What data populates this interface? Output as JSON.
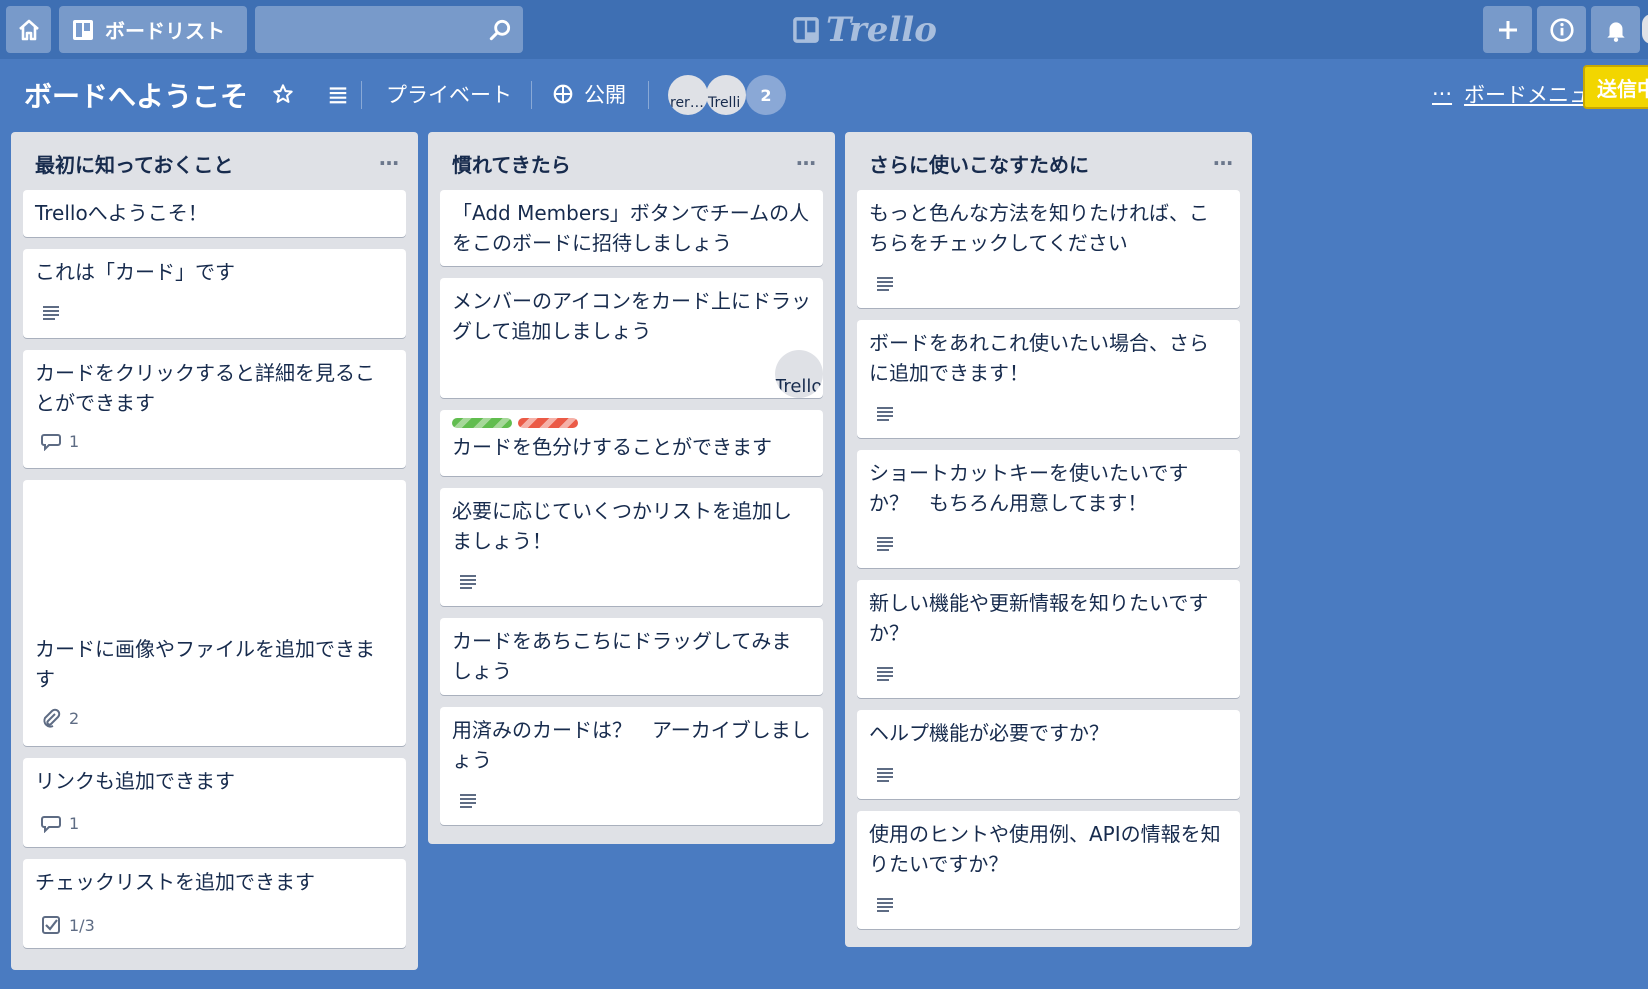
{
  "topbar": {
    "boards_label": "ボードリスト",
    "search_placeholder": "",
    "logo_text": "Trello"
  },
  "board": {
    "title": "ボードへようこそ",
    "privacy": "プライベート",
    "visibility": "公開",
    "members": [
      {
        "alt": "rer…"
      },
      {
        "alt": "Trelli"
      }
    ],
    "member_count": "2",
    "menu_label": "ボードメニュー",
    "sending_badge": "送信中"
  },
  "lists": [
    {
      "title": "最初に知っておくこと",
      "menu": "…",
      "cards": [
        {
          "title": "Trelloへようこそ！"
        },
        {
          "title": "これは「カード」です",
          "badge": "description"
        },
        {
          "title": "カードをクリックすると詳細を見ることができます",
          "comments": "1"
        },
        {
          "title": "カードに画像やファイルを追加できます",
          "attachments": "2"
        },
        {
          "title": "リンクも追加できます",
          "comments": "1"
        },
        {
          "title": "チェックリストを追加できます",
          "checklist": "1/3"
        }
      ]
    },
    {
      "title": "慣れてきたら",
      "menu": "…",
      "cards": [
        {
          "title": "「Add Members」ボタンでチームの人をこのボードに招待しましょう"
        },
        {
          "title": "メンバーのアイコンをカード上にドラッグして追加しましょう",
          "member": "Trello"
        },
        {
          "title": "カードを色分けすることができます",
          "labels": [
            "green",
            "red"
          ]
        },
        {
          "title": "必要に応じていくつかリストを追加しましょう！",
          "badge": "description"
        },
        {
          "title": "カードをあちこちにドラッグしてみましょう"
        },
        {
          "title": "用済みのカードは？　アーカイブしましょう",
          "badge": "description"
        }
      ]
    },
    {
      "title": "さらに使いこなすために",
      "menu": "…",
      "cards": [
        {
          "title": "もっと色んな方法を知りたければ、こちらをチェックしてください",
          "badge": "description"
        },
        {
          "title": "ボードをあれこれ使いたい場合、さらに追加できます！",
          "badge": "description"
        },
        {
          "title": "ショートカットキーを使いたいですか？　もちろん用意してます！",
          "badge": "description"
        },
        {
          "title": "新しい機能や更新情報を知りたいですか？",
          "badge": "description"
        },
        {
          "title": "ヘルプ機能が必要ですか？",
          "badge": "description"
        },
        {
          "title": "使用のヒントや使用例、APIの情報を知りたいですか？",
          "badge": "description"
        }
      ]
    }
  ],
  "colors": {
    "background": "#4a7bc1",
    "topbar": "#3e6fb3",
    "list": "#dfe1e6",
    "card": "#ffffff",
    "label_green": "#61bd4f",
    "label_red": "#eb5a46",
    "sending_badge": "#f2d600"
  }
}
